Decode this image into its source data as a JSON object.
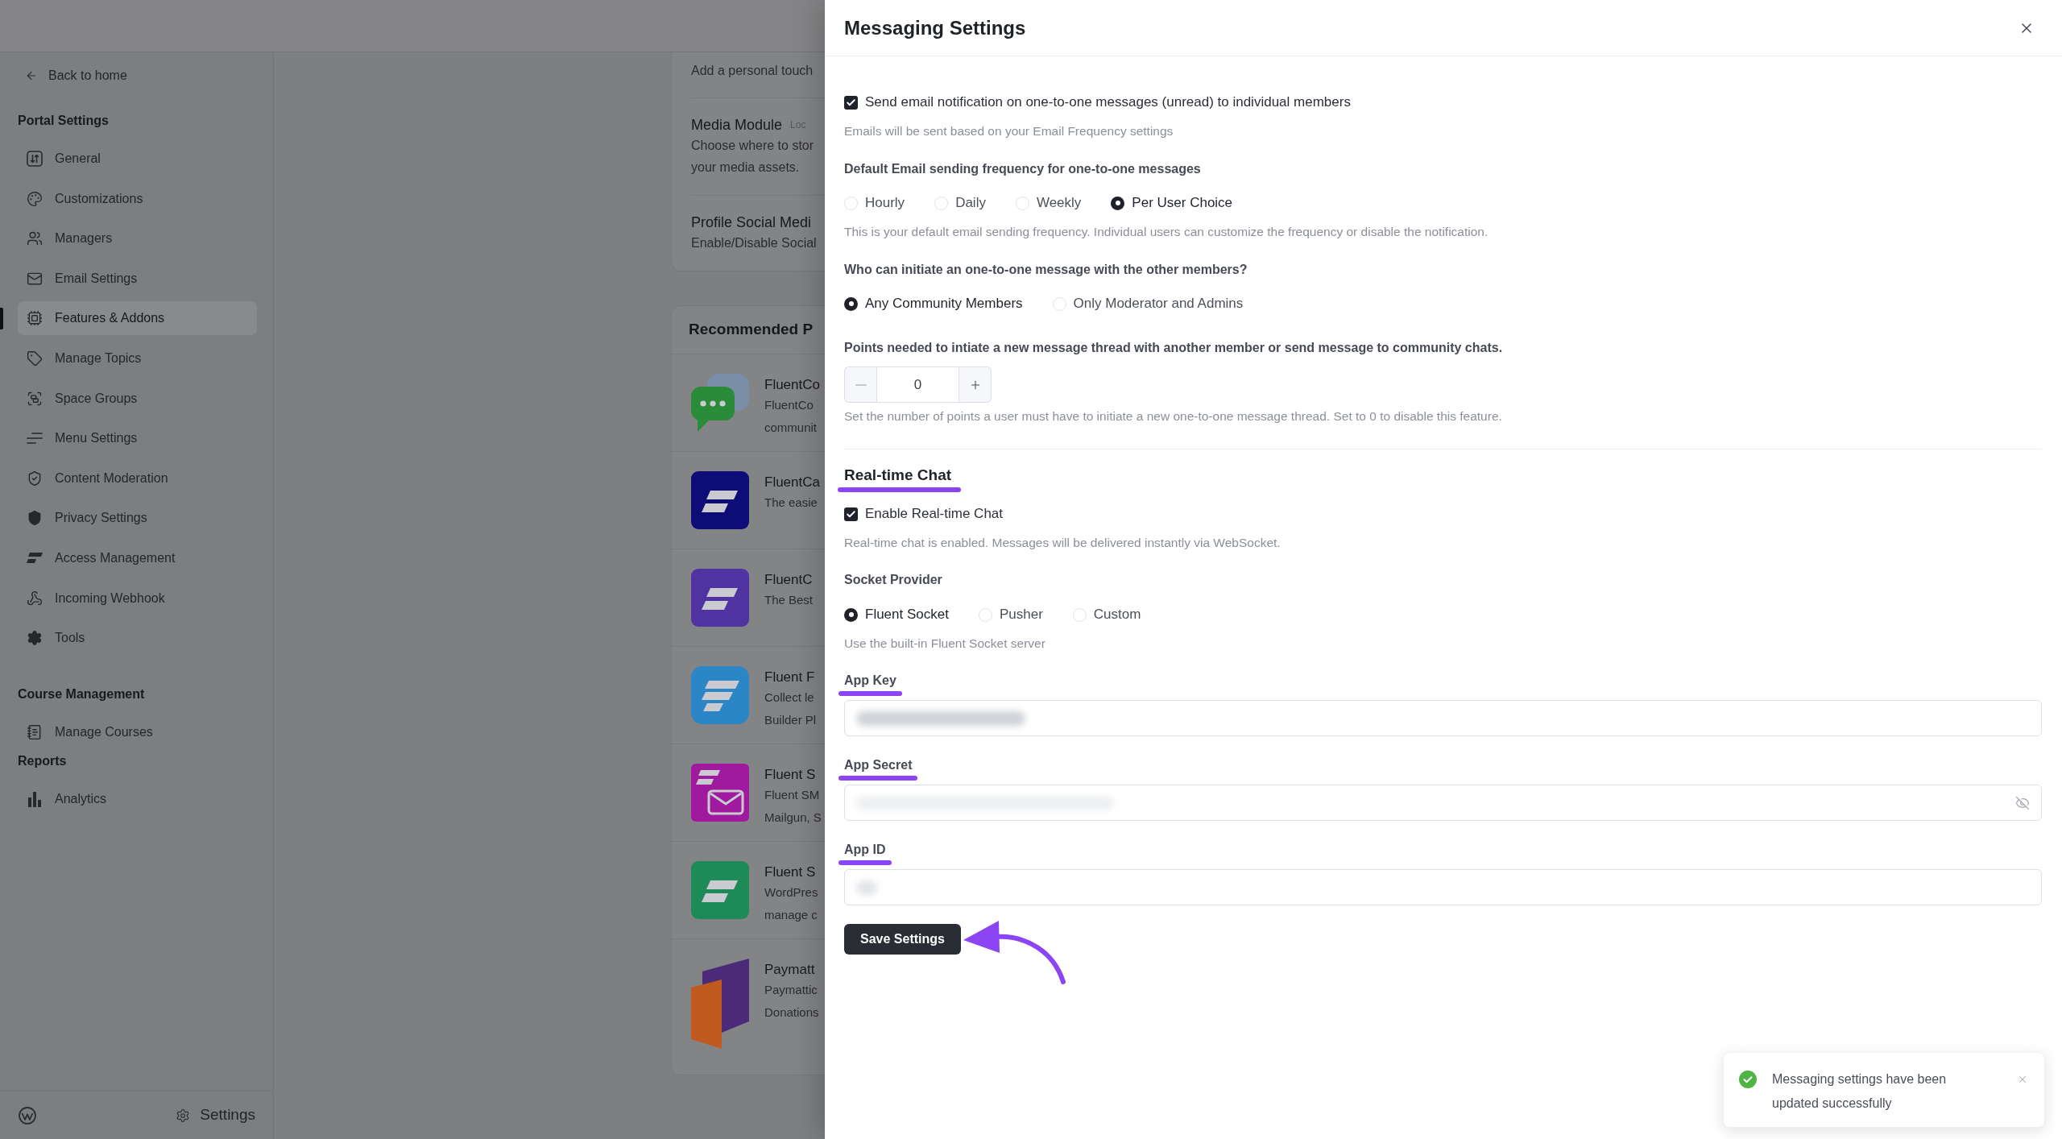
{
  "sidebar": {
    "back_link": "Back to home",
    "sections": [
      {
        "title": "Portal Settings",
        "items": [
          {
            "label": "General",
            "selected": false
          },
          {
            "label": "Customizations",
            "selected": false
          },
          {
            "label": "Managers",
            "selected": false
          },
          {
            "label": "Email Settings",
            "selected": false
          },
          {
            "label": "Features & Addons",
            "selected": true
          },
          {
            "label": "Manage Topics",
            "selected": false
          },
          {
            "label": "Space Groups",
            "selected": false
          },
          {
            "label": "Menu Settings",
            "selected": false
          },
          {
            "label": "Content Moderation",
            "selected": false
          },
          {
            "label": "Privacy Settings",
            "selected": false
          },
          {
            "label": "Access Management",
            "selected": false
          },
          {
            "label": "Incoming Webhook",
            "selected": false
          },
          {
            "label": "Tools",
            "selected": false
          }
        ]
      },
      {
        "title": "Course Management",
        "items": [
          {
            "label": "Manage Courses",
            "selected": false
          }
        ]
      },
      {
        "title": "Reports",
        "items": [
          {
            "label": "Analytics",
            "selected": false
          }
        ]
      }
    ],
    "footer": {
      "settings_label": "Settings"
    }
  },
  "features_card": {
    "items": [
      {
        "description": [
          "Add a personal touch"
        ]
      },
      {
        "title": "Media Module",
        "badge": "Loc",
        "description": [
          "Choose where to stor",
          "your media assets."
        ]
      },
      {
        "title": "Profile Social Medi",
        "description": [
          "Enable/Disable Social"
        ]
      }
    ]
  },
  "recommended_card": {
    "title": "Recommended P",
    "plugins": [
      {
        "name": "FluentCo",
        "description": [
          "FluentCo",
          "communit"
        ]
      },
      {
        "name": "FluentCa",
        "description": [
          "The easie"
        ]
      },
      {
        "name": "FluentC",
        "description": [
          "The Best"
        ]
      },
      {
        "name": "Fluent F",
        "description": [
          "Collect le",
          "Builder Pl"
        ]
      },
      {
        "name": "Fluent S",
        "description": [
          "Fluent SM",
          "Mailgun, S"
        ]
      },
      {
        "name": "Fluent S",
        "description": [
          "WordPres",
          "manage c"
        ]
      },
      {
        "name": "Paymatt",
        "description": [
          "Paymattic",
          "Donations"
        ]
      }
    ]
  },
  "drawer": {
    "title": "Messaging Settings",
    "email_notification": {
      "label": "Send email notification on one-to-one messages (unread) to individual members",
      "checked": true,
      "help": "Emails will be sent based on your Email Frequency settings"
    },
    "email_frequency": {
      "label": "Default Email sending frequency for one-to-one messages",
      "options": [
        {
          "label": "Hourly",
          "selected": false
        },
        {
          "label": "Daily",
          "selected": false
        },
        {
          "label": "Weekly",
          "selected": false
        },
        {
          "label": "Per User Choice",
          "selected": true
        }
      ],
      "help": "This is your default email sending frequency. Individual users can customize the frequency or disable the notification."
    },
    "message_initiator": {
      "label": "Who can initiate an one-to-one message with the other members?",
      "options": [
        {
          "label": "Any Community Members",
          "selected": true
        },
        {
          "label": "Only Moderator and Admins",
          "selected": false
        }
      ]
    },
    "points_required": {
      "label": "Points needed to intiate a new message thread with another member or send message to community chats.",
      "value": "0",
      "decrement_disabled": true,
      "help": "Set the number of points a user must have to initiate a new one-to-one message thread. Set to 0 to disable this feature."
    },
    "realtime_chat": {
      "title": "Real-time Chat",
      "highlighted": true,
      "enable": {
        "label": "Enable Real-time Chat",
        "checked": true,
        "help": "Real-time chat is enabled. Messages will be delivered instantly via WebSocket."
      },
      "socket_provider": {
        "label": "Socket Provider",
        "options": [
          {
            "label": "Fluent Socket",
            "selected": true
          },
          {
            "label": "Pusher",
            "selected": false
          },
          {
            "label": "Custom",
            "selected": false
          }
        ],
        "help": "Use the built-in Fluent Socket server"
      },
      "fields": [
        {
          "kind": "text",
          "label": "App Key",
          "highlighted": true,
          "blurred": true
        },
        {
          "kind": "password",
          "label": "App Secret",
          "highlighted": true,
          "blurred": true
        },
        {
          "kind": "text",
          "label": "App ID",
          "highlighted": true,
          "blurred": true
        }
      ]
    },
    "save_button": {
      "label": "Save Settings",
      "pointed_at": true
    }
  },
  "toast": {
    "message": "Messaging settings have been updated successfully"
  }
}
